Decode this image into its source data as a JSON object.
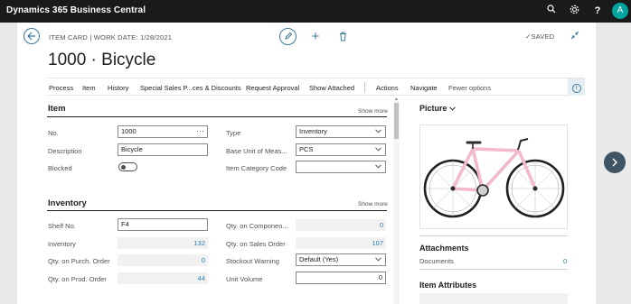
{
  "app": {
    "title": "Dynamics 365 Business Central",
    "user_initial": "A"
  },
  "header": {
    "caption": "ITEM CARD | WORK DATE: 1/28/2021",
    "saved_label": "SAVED",
    "page_title": "1000 · Bicycle"
  },
  "actions": [
    "Process",
    "Item",
    "History",
    "Special Sales P...ces & Discounts",
    "Request Approval",
    "Show Attached",
    "Actions",
    "Navigate",
    "Fewer options"
  ],
  "item_section": {
    "title": "Item",
    "show_more": "Show more",
    "no_label": "No.",
    "no_value": "1000",
    "description_label": "Description",
    "description_value": "Bicycle",
    "blocked_label": "Blocked",
    "type_label": "Type",
    "type_value": "Inventory",
    "base_uom_label": "Base Unit of Meas...",
    "base_uom_value": "PCS",
    "category_label": "Item Category Code",
    "category_value": ""
  },
  "inventory_section": {
    "title": "Inventory",
    "show_more": "Show more",
    "shelf_label": "Shelf No.",
    "shelf_value": "F4",
    "inventory_label": "Inventory",
    "inventory_value": "132",
    "qty_purch_label": "Qty. on Purch. Order",
    "qty_purch_value": "0",
    "qty_prod_label": "Qty. on Prod. Order",
    "qty_prod_value": "44",
    "qty_comp_label": "Qty. on Componen...",
    "qty_comp_value": "0",
    "qty_sales_label": "Qty. on Sales Order",
    "qty_sales_value": "107",
    "stockout_label": "Stockout Warning",
    "stockout_value": "Default (Yes)",
    "unit_volume_label": "Unit Volume",
    "unit_volume_value": "0"
  },
  "factbox": {
    "picture_title": "Picture",
    "attachments_title": "Attachments",
    "documents_label": "Documents",
    "documents_value": "0",
    "attributes_title": "Item Attributes"
  },
  "colors": {
    "accent": "#3a7a9a",
    "frame": "#1a1a1a",
    "bike": "#f3b9cc",
    "link": "#2a7fb5"
  }
}
